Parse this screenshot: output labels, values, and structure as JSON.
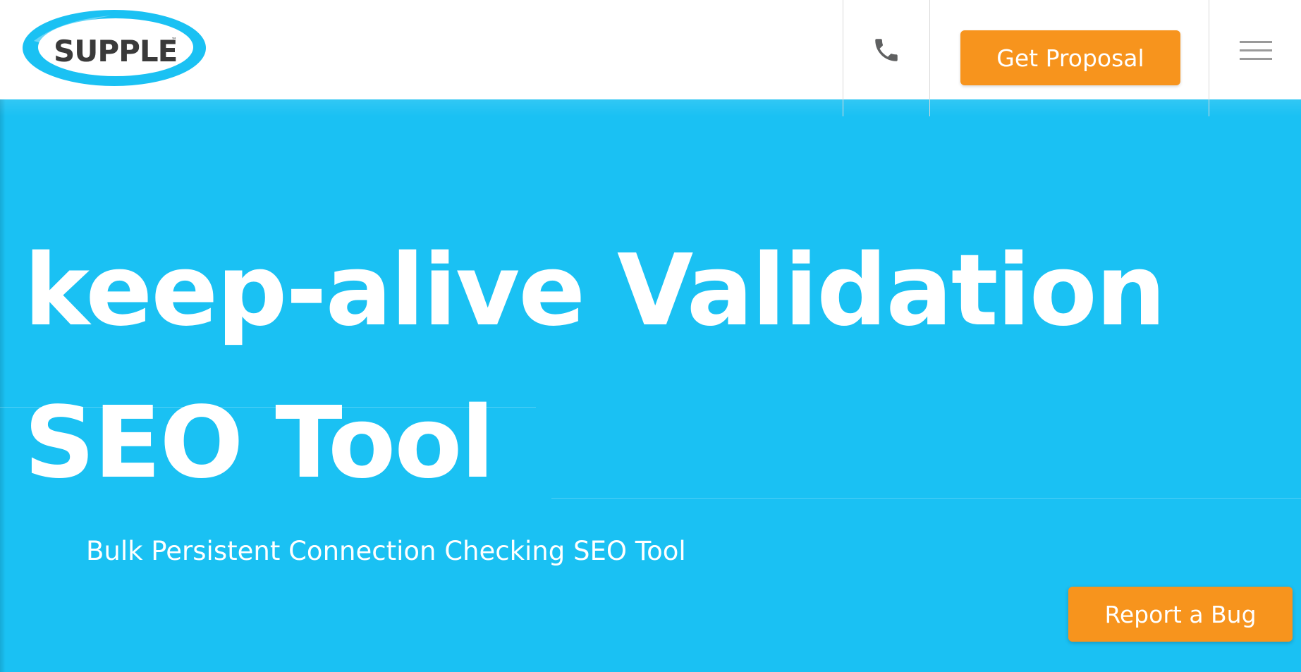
{
  "header": {
    "logo_text": "SUPPLE",
    "logo_tm": "™",
    "phone_icon": "phone-icon",
    "proposal_label": "Get Proposal",
    "menu_icon": "hamburger-menu-icon"
  },
  "hero": {
    "title": "keep-alive Validation SEO Tool",
    "subtitle": "Bulk Persistent Connection Checking SEO Tool"
  },
  "floating": {
    "bug_label": "Report a Bug"
  },
  "colors": {
    "hero_bg": "#1ac1f3",
    "accent": "#f7941d",
    "logo_ring": "#1ac1f3",
    "text_dark": "#3a3a3a"
  }
}
